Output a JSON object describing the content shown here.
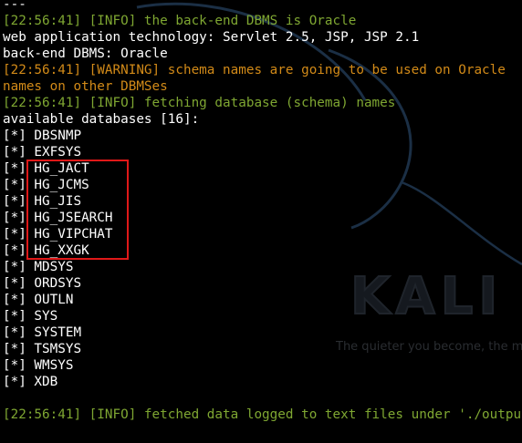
{
  "terminal": {
    "lines": [
      {
        "text": "---",
        "kind": "plain"
      },
      {
        "text": "[22:56:41] [INFO] the back-end DBMS is Oracle",
        "kind": "info"
      },
      {
        "text": "web application technology: Servlet 2.5, JSP, JSP 2.1",
        "kind": "plain"
      },
      {
        "text": "back-end DBMS: Oracle",
        "kind": "plain"
      },
      {
        "text": "[22:56:41] [WARNING] schema names are going to be used on Oracle",
        "kind": "warn"
      },
      {
        "text": "names on other DBMSes",
        "kind": "warn"
      },
      {
        "text": "[22:56:41] [INFO] fetching database (schema) names",
        "kind": "info"
      },
      {
        "text": "available databases [16]:",
        "kind": "plain"
      },
      {
        "text": "[*] DBSNMP",
        "kind": "plain"
      },
      {
        "text": "[*] EXFSYS",
        "kind": "plain"
      },
      {
        "text": "[*] HG_JACT",
        "kind": "plain"
      },
      {
        "text": "[*] HG_JCMS",
        "kind": "plain"
      },
      {
        "text": "[*] HG_JIS",
        "kind": "plain"
      },
      {
        "text": "[*] HG_JSEARCH",
        "kind": "plain"
      },
      {
        "text": "[*] HG_VIPCHAT",
        "kind": "plain"
      },
      {
        "text": "[*] HG_XXGK",
        "kind": "plain"
      },
      {
        "text": "[*] MDSYS",
        "kind": "plain"
      },
      {
        "text": "[*] ORDSYS",
        "kind": "plain"
      },
      {
        "text": "[*] OUTLN",
        "kind": "plain"
      },
      {
        "text": "[*] SYS",
        "kind": "plain"
      },
      {
        "text": "[*] SYSTEM",
        "kind": "plain"
      },
      {
        "text": "[*] TSMSYS",
        "kind": "plain"
      },
      {
        "text": "[*] WMSYS",
        "kind": "plain"
      },
      {
        "text": "[*] XDB",
        "kind": "plain"
      },
      {
        "text": "",
        "kind": "plain"
      },
      {
        "text": "[22:56:41] [INFO] fetched data logged to text files under './output/",
        "kind": "info"
      }
    ]
  },
  "wallpaper": {
    "logo_text": "KALI LI",
    "tagline": "The quieter you become, the m"
  },
  "colors": {
    "background": "#000000",
    "info": "#7fa732",
    "warning": "#d28a18",
    "plain": "#ffffff",
    "highlight": "#e01818"
  },
  "highlighted_databases": [
    "HG_JACT",
    "HG_JCMS",
    "HG_JIS",
    "HG_JSEARCH",
    "HG_VIPCHAT",
    "HG_XXGK"
  ]
}
